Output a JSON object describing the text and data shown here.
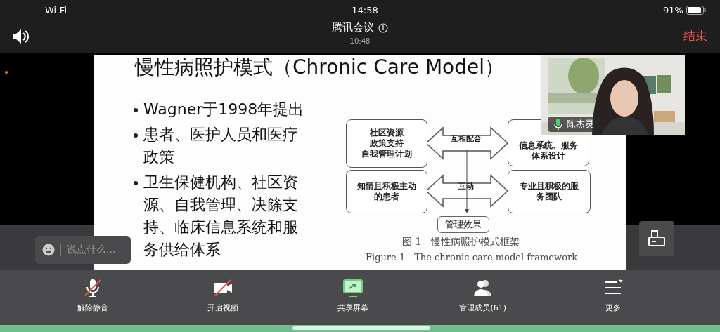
{
  "status_bar": {
    "network": "Wi-Fi",
    "time": "14:58",
    "battery": "91%"
  },
  "header": {
    "title": "腾讯会议",
    "duration": "10:48",
    "end_button": "结束"
  },
  "slide": {
    "title": "慢性病照护模式（Chronic Care Model）",
    "bullets": [
      "Wagner于1998年提出",
      "患者、医护人员和医疗政策",
      "卫生保健机构、社区资源、自我管理、决篨支持、临床信息系统和服务供给体系"
    ],
    "diagram": {
      "left_boxes": [
        [
          "社区资源",
          "政策支持",
          "自我管理计划"
        ],
        [
          "知情且积极主动",
          "的患者"
        ]
      ],
      "right_boxes": [
        [
          "信息系统、服务",
          "体系设计"
        ],
        [
          "专业且积极的服",
          "务团队"
        ]
      ],
      "arrow_labels": [
        "互相配合",
        "互动"
      ],
      "outcome": "管理效果",
      "caption_cn": "图 1　慢性病照护模式框架",
      "caption_en": "Figure 1　The chronic care model framework"
    }
  },
  "video_tile": {
    "kind": "picture",
    "participant": "陈杰灵",
    "mic_on": true
  },
  "chat": {
    "placeholder": "说点什么..."
  },
  "toolbar": [
    {
      "kind": "mic",
      "off": true,
      "label": "解除静音"
    },
    {
      "kind": "camera",
      "off": true,
      "label": "开启视频"
    },
    {
      "kind": "share",
      "off": false,
      "label": "共享屏幕"
    },
    {
      "kind": "members",
      "off": false,
      "label": "管理成员(61)"
    },
    {
      "kind": "more",
      "off": false,
      "label": "更多"
    }
  ]
}
